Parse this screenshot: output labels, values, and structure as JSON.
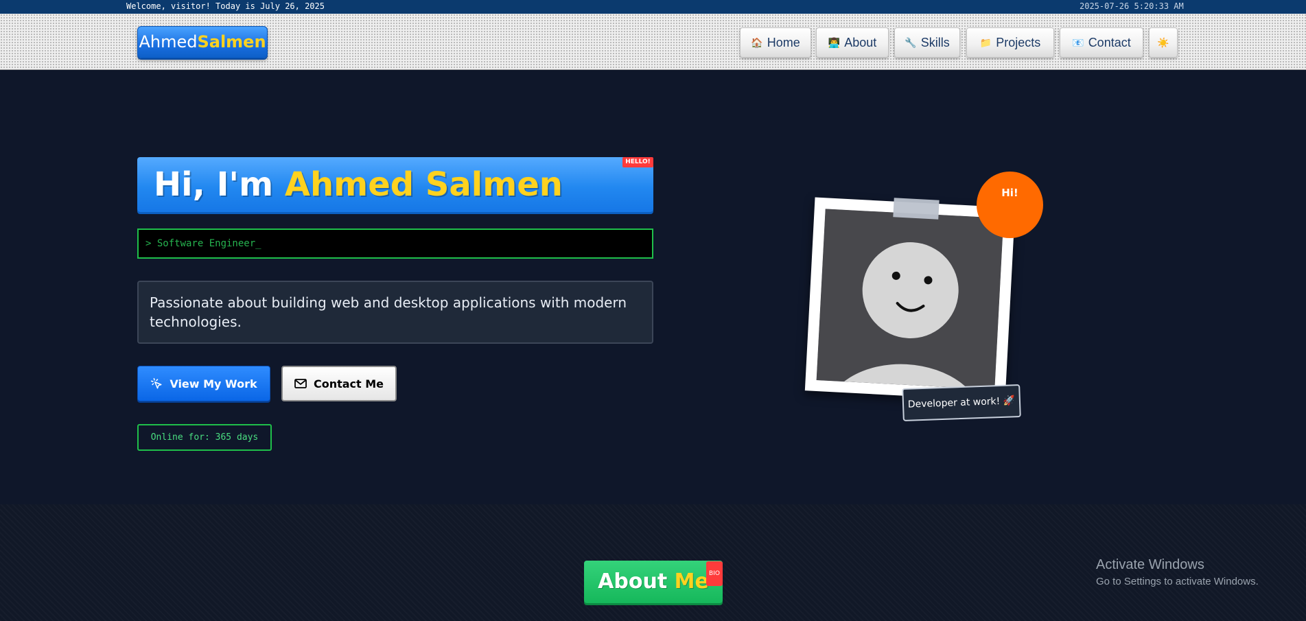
{
  "topbar": {
    "welcome": "Welcome, visitor! Today is July 26, 2025",
    "clock": "2025-07-26 5:20:33 AM"
  },
  "logo": {
    "part1": "Ahmed",
    "part2": "Salmen"
  },
  "nav": {
    "items": [
      {
        "label": "Home",
        "icon": "🏠"
      },
      {
        "label": "About",
        "icon": "👨‍💻"
      },
      {
        "label": "Skills",
        "icon": "🔧"
      },
      {
        "label": "Projects",
        "icon": "📁"
      },
      {
        "label": "Contact",
        "icon": "📧"
      }
    ],
    "theme_icon": "☀️"
  },
  "hero": {
    "greeting": "Hi, I'm ",
    "name": "Ahmed Salmen",
    "badge": "HELLO!",
    "terminal": "> Software Engineer_",
    "bio": "Passionate about building web and desktop applications with modern technologies.",
    "primary_button": "View My Work",
    "secondary_button": "Contact Me",
    "online": "Online for: 365 days"
  },
  "photo": {
    "bubble": "Hi!",
    "caption": "Developer at work! 🚀"
  },
  "about": {
    "title_part1": "About ",
    "title_part2": "Me",
    "badge": "BIO"
  },
  "watermark": {
    "title": "Activate Windows",
    "subtitle": "Go to Settings to activate Windows."
  },
  "colors": {
    "accent_blue": "#1677e6",
    "accent_yellow": "#ffd21f",
    "terminal_green": "#1fbf4a",
    "bubble_orange": "#ff6a00",
    "background": "#0f172a"
  }
}
